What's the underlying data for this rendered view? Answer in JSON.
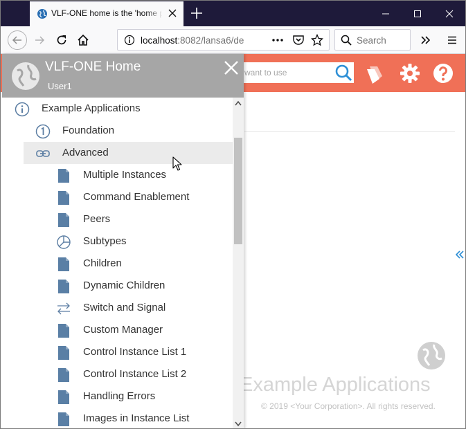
{
  "browser": {
    "tab_title": "VLF-ONE home is the 'home pa",
    "url_host": "localhost",
    "url_rest": ":8082/lansa6/de",
    "search_placeholder": "Search"
  },
  "app": {
    "search_placeholder": "want to use",
    "background_title": "Example Applications",
    "copyright": "© 2019 <Your Corporation>. All rights reserved.",
    "accent_color": "#f07057"
  },
  "panel": {
    "title": "VLF-ONE Home",
    "user": "User1",
    "header_color": "#a6a6a6"
  },
  "tree": {
    "items": [
      {
        "label": "Example Applications",
        "icon": "info-icon",
        "level": 0
      },
      {
        "label": "Foundation",
        "icon": "number-one-icon",
        "level": 1
      },
      {
        "label": "Advanced",
        "icon": "link-icon",
        "level": 1,
        "selected": true
      },
      {
        "label": "Multiple Instances",
        "icon": "document-icon",
        "level": 2
      },
      {
        "label": "Command Enablement",
        "icon": "document-icon",
        "level": 2
      },
      {
        "label": "Peers",
        "icon": "document-icon",
        "level": 2
      },
      {
        "label": "Subtypes",
        "icon": "pie-chart-icon",
        "level": 2
      },
      {
        "label": "Children",
        "icon": "document-icon",
        "level": 2
      },
      {
        "label": "Dynamic Children",
        "icon": "document-icon",
        "level": 2
      },
      {
        "label": "Switch and Signal",
        "icon": "switch-arrows-icon",
        "level": 2
      },
      {
        "label": "Custom Manager",
        "icon": "document-icon",
        "level": 2
      },
      {
        "label": "Control Instance List 1",
        "icon": "document-icon",
        "level": 2
      },
      {
        "label": "Control Instance List 2",
        "icon": "document-icon",
        "level": 2
      },
      {
        "label": "Handling Errors",
        "icon": "document-icon",
        "level": 2
      },
      {
        "label": "Images in Instance List",
        "icon": "document-icon",
        "level": 2
      }
    ]
  }
}
